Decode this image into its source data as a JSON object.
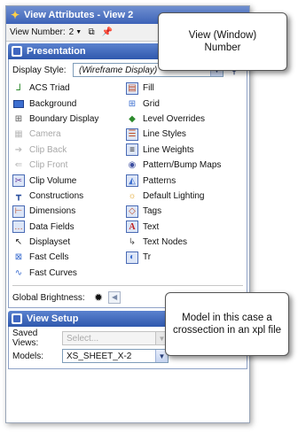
{
  "window": {
    "title": "View Attributes - View 2",
    "view_number_label": "View Number:",
    "view_number_value": "2"
  },
  "presentation": {
    "header": "Presentation",
    "display_style_label": "Display Style:",
    "display_style_value": "(Wireframe Display)",
    "left_items": [
      {
        "label": "ACS Triad",
        "icon": "acs-triad-icon"
      },
      {
        "label": "Background",
        "icon": "background-icon"
      },
      {
        "label": "Boundary Display",
        "icon": "boundary-display-icon"
      },
      {
        "label": "Camera",
        "icon": "camera-icon"
      },
      {
        "label": "Clip Back",
        "icon": "clip-back-icon"
      },
      {
        "label": "Clip Front",
        "icon": "clip-front-icon"
      },
      {
        "label": "Clip Volume",
        "icon": "clip-volume-icon"
      },
      {
        "label": "Constructions",
        "icon": "constructions-icon"
      },
      {
        "label": "Dimensions",
        "icon": "dimensions-icon"
      },
      {
        "label": "Data Fields",
        "icon": "data-fields-icon"
      },
      {
        "label": "Displayset",
        "icon": "displayset-icon"
      },
      {
        "label": "Fast Cells",
        "icon": "fast-cells-icon"
      },
      {
        "label": "Fast Curves",
        "icon": "fast-curves-icon"
      }
    ],
    "right_items": [
      {
        "label": "Fill",
        "icon": "fill-icon"
      },
      {
        "label": "Grid",
        "icon": "grid-icon"
      },
      {
        "label": "Level Overrides",
        "icon": "level-overrides-icon"
      },
      {
        "label": "Line Styles",
        "icon": "line-styles-icon"
      },
      {
        "label": "Line Weights",
        "icon": "line-weights-icon"
      },
      {
        "label": "Pattern/Bump Maps",
        "icon": "pattern-bump-maps-icon"
      },
      {
        "label": "Patterns",
        "icon": "patterns-icon"
      },
      {
        "label": "Default Lighting",
        "icon": "default-lighting-icon"
      },
      {
        "label": "Tags",
        "icon": "tags-icon"
      },
      {
        "label": "Text",
        "icon": "text-icon"
      },
      {
        "label": "Text Nodes",
        "icon": "text-nodes-icon"
      },
      {
        "label": "Tr",
        "icon": "transparency-icon"
      }
    ],
    "global_brightness_label": "Global Brightness:"
  },
  "view_setup": {
    "header": "View Setup",
    "saved_views_label": "Saved Views:",
    "saved_views_placeholder": "Select...",
    "models_label": "Models:",
    "models_value": "XS_SHEET_X-2"
  },
  "callouts": {
    "view_number": "View (Window) Number",
    "model": "Model in this case a crossection in an xpl file"
  }
}
